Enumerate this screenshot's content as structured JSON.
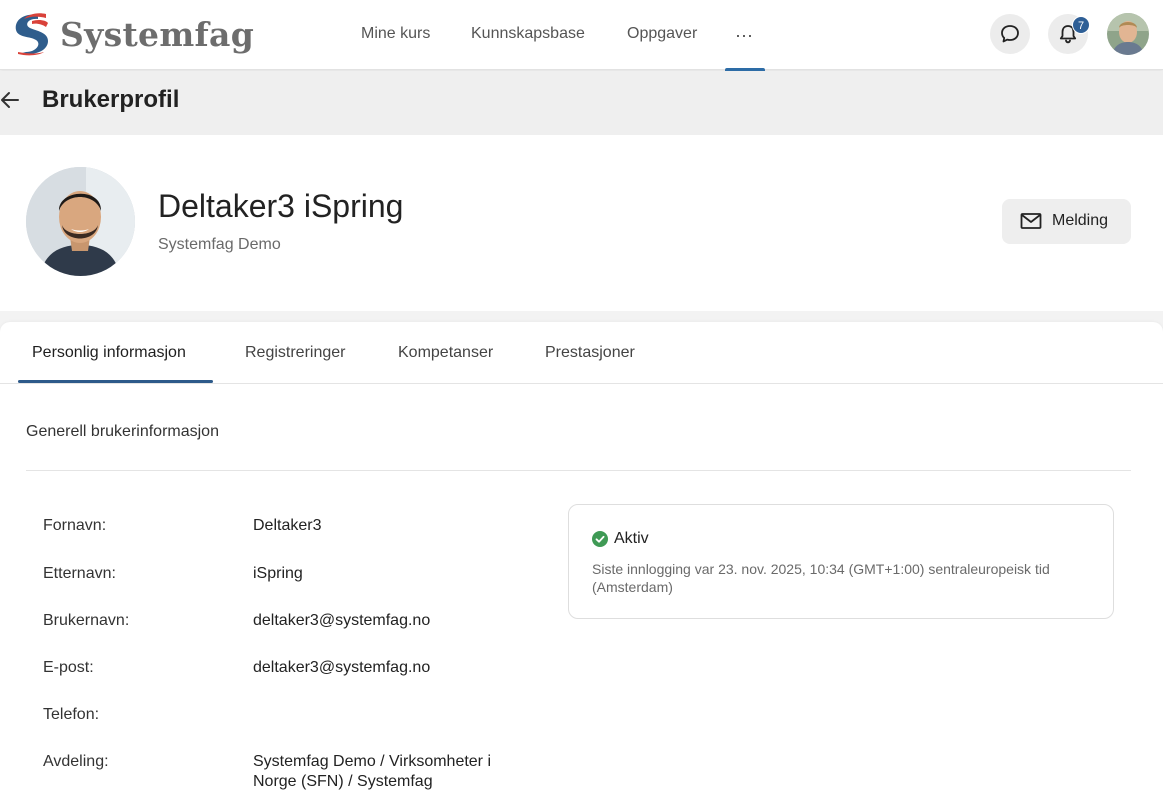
{
  "brand": {
    "name": "Systemfag"
  },
  "nav": {
    "items": [
      "Mine kurs",
      "Kunnskapsbase",
      "Oppgaver"
    ],
    "more_label": "···",
    "notification_count": "7"
  },
  "page": {
    "title": "Brukerprofil"
  },
  "profile": {
    "name": "Deltaker3 iSpring",
    "organization": "Systemfag Demo",
    "message_button": "Melding"
  },
  "tabs": [
    "Personlig informasjon",
    "Registreringer",
    "Kompetanser",
    "Prestasjoner"
  ],
  "active_tab": "Personlig informasjon",
  "section": {
    "title": "Generell brukerinformasjon"
  },
  "fields": [
    {
      "label": "Fornavn:",
      "value": "Deltaker3"
    },
    {
      "label": "Etternavn:",
      "value": "iSpring"
    },
    {
      "label": "Brukernavn:",
      "value": "deltaker3@systemfag.no"
    },
    {
      "label": "E-post:",
      "value": "deltaker3@systemfag.no"
    },
    {
      "label": "Telefon:",
      "value": ""
    },
    {
      "label": "Avdeling:",
      "value": "Systemfag Demo / Virksomheter i Norge (SFN) / Systemfag"
    }
  ],
  "status": {
    "label": "Aktiv",
    "last_login": "Siste innlogging var 23. nov. 2025, 10:34 (GMT+1:00) sentraleuropeisk tid (Amsterdam)"
  },
  "colors": {
    "accent": "#2d6ca6",
    "badge": "#2e5f96",
    "status_ok": "#3f9a55",
    "logo_red": "#d9423a",
    "logo_blue": "#2f5d8c"
  },
  "icons": [
    "logo-icon",
    "chat-icon",
    "bell-icon",
    "back-arrow-icon",
    "envelope-icon",
    "check-circle-icon"
  ]
}
